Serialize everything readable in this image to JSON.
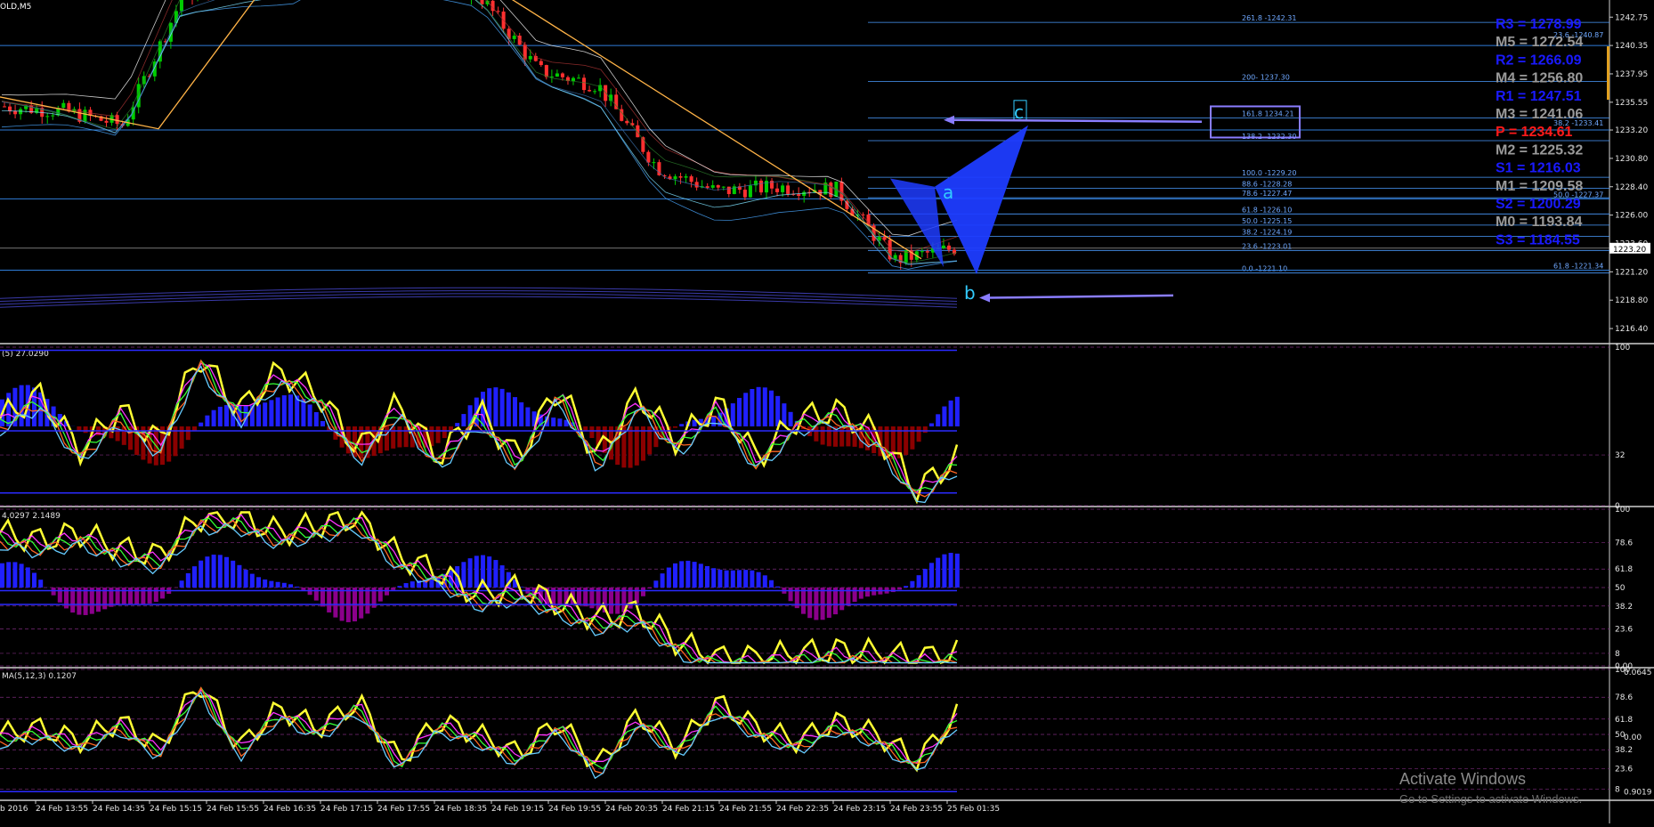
{
  "window": {
    "symbol_label": "OLD,M5",
    "activation_title": "Activate Windows",
    "activation_subtitle": "Go to Settings to activate Windows."
  },
  "colors": {
    "background": "#000000",
    "bull_candle": "#00cc00",
    "bear_candle": "#ff3030",
    "fib_lines": "#4a9cff",
    "pivot_blue": "#1a1aff",
    "pivot_gray": "#9a9a9a",
    "pivot_red": "#ff1a1a",
    "pattern_fill": "#1e3cff",
    "indicator_yellow": "#ffff33",
    "hist_blue": "#2020ff",
    "hist_darkred": "#8b0000",
    "hist_purple": "#8b008b"
  },
  "chart_data": [
    {
      "type": "line",
      "panel": "price",
      "title": "OLD,M5",
      "x": [
        "24 Feb 13:55",
        "24 Feb 14:35",
        "24 Feb 15:15",
        "24 Feb 15:55",
        "24 Feb 16:35",
        "24 Feb 17:15",
        "24 Feb 17:55",
        "24 Feb 18:35",
        "24 Feb 19:15",
        "24 Feb 19:55",
        "24 Feb 20:35",
        "24 Feb 21:15",
        "24 Feb 21:55",
        "24 Feb 22:35",
        "24 Feb 23:15",
        "24 Feb 23:55",
        "25 Feb 01:35"
      ],
      "x_first_label": "b 2016",
      "series": [
        {
          "values": [
            1235.2,
            1234.8,
            1233.6,
            1244.5,
            1245.8,
            1246.5,
            1251.0,
            1246.2,
            1244.6,
            1238.2,
            1237.0,
            1230.0,
            1228.0,
            1228.4,
            1228.2,
            1222.2,
            1223.2
          ]
        }
      ],
      "y_ticks": [
        1242.75,
        1240.35,
        1237.95,
        1235.55,
        1233.2,
        1230.8,
        1228.4,
        1226.0,
        1223.6,
        1221.2,
        1218.8,
        1216.4
      ],
      "ylim": [
        1215.2,
        1244.2
      ],
      "current_price": "1223.20",
      "annotations": {
        "pattern_labels": [
          "a",
          "b",
          "c"
        ],
        "fib_levels": [
          {
            "label": "261.8 -1242.31",
            "value": 1242.31
          },
          {
            "label": "200- 1237.30",
            "value": 1237.3
          },
          {
            "label": "161.8 1234.21",
            "value": 1234.21
          },
          {
            "label": "138.2 -1232.30",
            "value": 1232.3
          },
          {
            "label": "100.0 -1229.20",
            "value": 1229.2
          },
          {
            "label": "88.6 -1228.28",
            "value": 1228.28
          },
          {
            "label": "78.6 -1227.47",
            "value": 1227.47
          },
          {
            "label": "61.8 -1226.10",
            "value": 1226.1
          },
          {
            "label": "50.0 -1225.15",
            "value": 1225.15
          },
          {
            "label": "38.2 -1224.19",
            "value": 1224.19
          },
          {
            "label": "23.6 -1223.01",
            "value": 1223.01
          },
          {
            "label": "0.0 -1221.10",
            "value": 1221.1
          }
        ],
        "right_fib_labels": [
          {
            "label": "23.6 -1240.87",
            "value": 1240.87
          },
          {
            "label": "38.2 -1233.41",
            "value": 1233.41
          },
          {
            "label": "50.0 -1227.37",
            "value": 1227.37
          },
          {
            "label": "61.8 -1221.34",
            "value": 1221.34
          }
        ]
      },
      "pivots": [
        {
          "label": "R3 = 1278.99",
          "color": "blue"
        },
        {
          "label": "M5 = 1272.54",
          "color": "gray"
        },
        {
          "label": "R2 = 1266.09",
          "color": "blue"
        },
        {
          "label": "M4 = 1256.80",
          "color": "gray"
        },
        {
          "label": "R1 = 1247.51",
          "color": "blue"
        },
        {
          "label": "M3 = 1241.06",
          "color": "gray"
        },
        {
          "label": "P   = 1234.61",
          "color": "red"
        },
        {
          "label": "M2 = 1225.32",
          "color": "gray"
        },
        {
          "label": "S1 = 1216.03",
          "color": "blue"
        },
        {
          "label": "M1 = 1209.58",
          "color": "gray"
        },
        {
          "label": "S2 = 1200.29",
          "color": "blue"
        },
        {
          "label": "M0 = 1193.84",
          "color": "gray"
        },
        {
          "label": "S3 = 1184.55",
          "color": "blue"
        }
      ]
    },
    {
      "type": "line",
      "panel": "oscillator-1",
      "title": "(5) 27.0290",
      "y_ticks": [
        "100",
        "32",
        "0"
      ],
      "ylim": [
        0,
        100
      ],
      "series": [
        {
          "name": "",
          "values": [
            55,
            70,
            35,
            60,
            40,
            95,
            60,
            85,
            70,
            35,
            65,
            30,
            60,
            30,
            75,
            30,
            70,
            40,
            65,
            30,
            55,
            60,
            45,
            10,
            30
          ]
        }
      ]
    },
    {
      "type": "line",
      "panel": "oscillator-2",
      "title": "4.0297 2.1489",
      "y_ticks": [
        "100",
        "78.6",
        "61.8",
        "50",
        "38.2",
        "23.6",
        "8",
        "0.00"
      ],
      "ylim": [
        0,
        100
      ],
      "series": [
        {
          "name": "",
          "values": [
            85,
            80,
            85,
            75,
            70,
            95,
            95,
            85,
            90,
            95,
            70,
            60,
            45,
            50,
            40,
            30,
            35,
            15,
            5,
            5,
            8,
            10,
            8,
            5,
            8
          ]
        }
      ]
    },
    {
      "type": "line",
      "panel": "oscillator-3",
      "title": "MA(5,12,3) 0.1207",
      "y_ticks": [
        "100",
        "78.6",
        "61.8",
        "50",
        "38.2",
        "23.6",
        "8"
      ],
      "extra_labels": [
        "0.0645",
        "0.00",
        "0.9019"
      ],
      "ylim": [
        0,
        100
      ],
      "series": [
        {
          "name": "",
          "values": [
            50,
            55,
            45,
            60,
            40,
            90,
            40,
            70,
            55,
            75,
            30,
            60,
            50,
            35,
            60,
            25,
            65,
            40,
            75,
            55,
            45,
            60,
            50,
            30,
            65
          ]
        }
      ]
    }
  ]
}
